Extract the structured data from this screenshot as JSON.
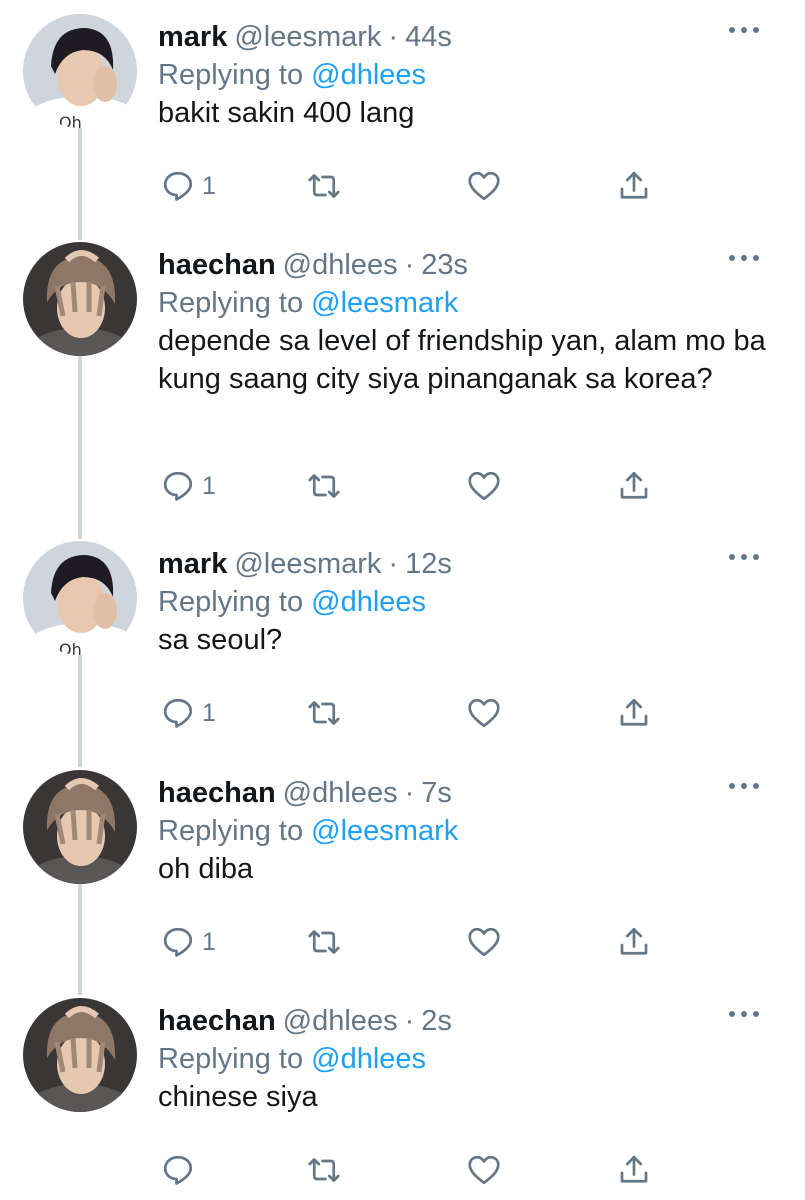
{
  "tweets": [
    {
      "name": "mark",
      "handle": "@leesmark",
      "dot": "·",
      "time": "44s",
      "replying": "Replying to",
      "reply_handle": "@dhlees",
      "text": "bakit sakin 400 lang",
      "reply_count": "1",
      "avatar": "mark"
    },
    {
      "name": "haechan",
      "handle": "@dhlees",
      "dot": "·",
      "time": "23s",
      "replying": "Replying to",
      "reply_handle": "@leesmark",
      "text": "depende sa level of friendship yan, alam mo ba kung saang city siya pinanganak sa korea?",
      "reply_count": "1",
      "avatar": "haechan"
    },
    {
      "name": "mark",
      "handle": "@leesmark",
      "dot": "·",
      "time": "12s",
      "replying": "Replying to",
      "reply_handle": "@dhlees",
      "text": "sa seoul?",
      "reply_count": "1",
      "avatar": "mark"
    },
    {
      "name": "haechan",
      "handle": "@dhlees",
      "dot": "·",
      "time": "7s",
      "replying": "Replying to",
      "reply_handle": "@leesmark",
      "text": "oh diba",
      "reply_count": "1",
      "avatar": "haechan"
    },
    {
      "name": "haechan",
      "handle": "@dhlees",
      "dot": "·",
      "time": "2s",
      "replying": "Replying to",
      "reply_handle": "@dhlees",
      "text": "chinese siya",
      "reply_count": "",
      "avatar": "haechan"
    }
  ],
  "icons": {
    "reply": "reply-icon",
    "retweet": "retweet-icon",
    "like": "heart-icon",
    "share": "share-icon",
    "more": "more-icon"
  },
  "colors": {
    "link": "#1da1f2",
    "muted": "#657786",
    "text": "#14171a",
    "thread_line": "#ccd6dd"
  }
}
